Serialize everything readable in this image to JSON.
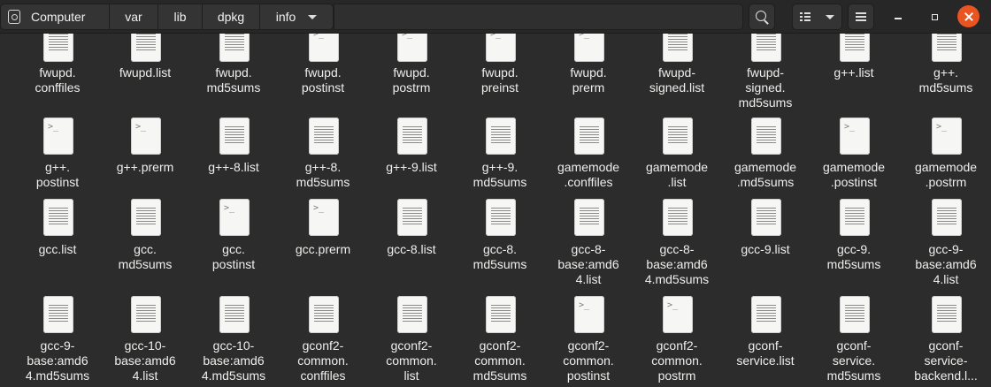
{
  "header": {
    "crumbs": [
      "Computer",
      "var",
      "lib",
      "dpkg",
      "info"
    ]
  },
  "rows": [
    [
      "fwupd.\nconffiles",
      "fwupd.list",
      "fwupd.\nmd5sums",
      "fwupd.\npostinst",
      "fwupd.\npostrm",
      "fwupd.\npreinst",
      "fwupd.\nprerm",
      "fwupd-\nsigned.list",
      "fwupd-\nsigned.\nmd5sums",
      "g++.list",
      "g++.\nmd5sums"
    ],
    [
      "g++.\npostinst",
      "g++.prerm",
      "g++-8.list",
      "g++-8.\nmd5sums",
      "g++-9.list",
      "g++-9.\nmd5sums",
      "gamemode\n.conffiles",
      "gamemode\n.list",
      "gamemode\n.md5sums",
      "gamemode\n.postinst",
      "gamemode\n.postrm"
    ],
    [
      "gcc.list",
      "gcc.\nmd5sums",
      "gcc.\npostinst",
      "gcc.prerm",
      "gcc-8.list",
      "gcc-8.\nmd5sums",
      "gcc-8-\nbase:amd6\n4.list",
      "gcc-8-\nbase:amd6\n4.md5sums",
      "gcc-9.list",
      "gcc-9.\nmd5sums",
      "gcc-9-\nbase:amd6\n4.list"
    ],
    [
      "gcc-9-\nbase:amd6\n4.md5sums",
      "gcc-10-\nbase:amd6\n4.list",
      "gcc-10-\nbase:amd6\n4.md5sums",
      "gconf2-\ncommon.\nconffiles",
      "gconf2-\ncommon.\nlist",
      "gconf2-\ncommon.\nmd5sums",
      "gconf2-\ncommon.\npostinst",
      "gconf2-\ncommon.\npostrm",
      "gconf-\nservice.list",
      "gconf-\nservice.\nmd5sums",
      "gconf-\nservice-\nbackend.l..."
    ]
  ],
  "icon_types": [
    [
      "text",
      "text",
      "text",
      "script",
      "script",
      "script",
      "script",
      "text",
      "text",
      "text",
      "text"
    ],
    [
      "script",
      "script",
      "text",
      "text",
      "text",
      "text",
      "text",
      "text",
      "text",
      "script",
      "script"
    ],
    [
      "text",
      "text",
      "script",
      "script",
      "text",
      "text",
      "text",
      "text",
      "text",
      "text",
      "text"
    ],
    [
      "text",
      "text",
      "text",
      "text",
      "text",
      "text",
      "script",
      "script",
      "text",
      "text",
      "text"
    ]
  ],
  "icons": {
    "text_file": "text-file-icon",
    "script_file": "script-file-icon",
    "search": "search-icon",
    "list_view": "list-view-icon",
    "menu": "hamburger-menu-icon"
  }
}
